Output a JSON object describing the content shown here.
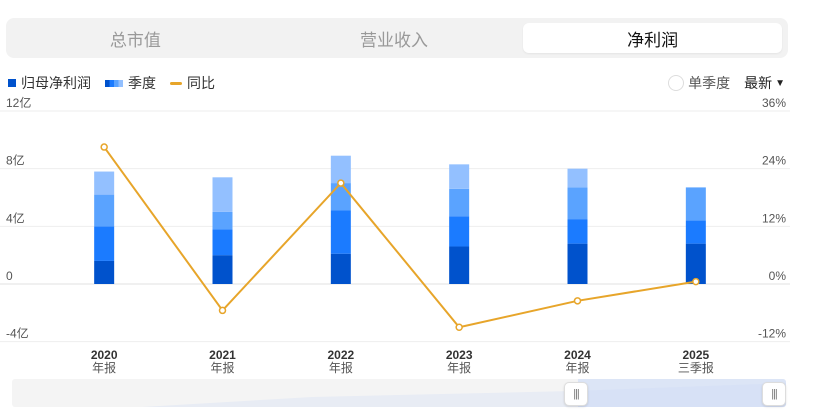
{
  "tabs": [
    {
      "label": "总市值",
      "active": false
    },
    {
      "label": "营业收入",
      "active": false
    },
    {
      "label": "净利润",
      "active": true
    }
  ],
  "legend": {
    "series1": "归母净利润",
    "series2": "季度",
    "series3": "同比"
  },
  "controls": {
    "single_quarter": "单季度",
    "latest": "最新"
  },
  "colors": {
    "q1": "#0052cc",
    "q2": "#1b7bff",
    "q3": "#5aa3ff",
    "q4": "#93c0ff",
    "yoy": "#e7a52a"
  },
  "chart_data": {
    "type": "bar",
    "categories": [
      {
        "year": "2020",
        "sub": "年报"
      },
      {
        "year": "2021",
        "sub": "年报"
      },
      {
        "year": "2022",
        "sub": "年报"
      },
      {
        "year": "2023",
        "sub": "年报"
      },
      {
        "year": "2024",
        "sub": "年报"
      },
      {
        "year": "2025",
        "sub": "三季报"
      }
    ],
    "quarters": [
      [
        1.6,
        2.4,
        2.2,
        1.6
      ],
      [
        2.0,
        1.8,
        1.2,
        2.4
      ],
      [
        2.1,
        3.0,
        1.9,
        1.9
      ],
      [
        2.6,
        2.1,
        1.9,
        1.7
      ],
      [
        2.8,
        1.7,
        2.2,
        1.3
      ],
      [
        2.8,
        1.6,
        2.3,
        null
      ]
    ],
    "yoy": [
      28.5,
      -5.5,
      21.0,
      -9.0,
      -3.5,
      0.5
    ],
    "y_left": {
      "min": -4,
      "max": 12,
      "ticks": [
        "12亿",
        "8亿",
        "4亿",
        "0",
        "-4亿"
      ],
      "values": [
        12,
        8,
        4,
        0,
        -4
      ]
    },
    "y_right": {
      "min": -12,
      "max": 36,
      "ticks": [
        "36%",
        "24%",
        "12%",
        "0%",
        "-12%"
      ],
      "values": [
        36,
        24,
        12,
        0,
        -12
      ]
    }
  }
}
